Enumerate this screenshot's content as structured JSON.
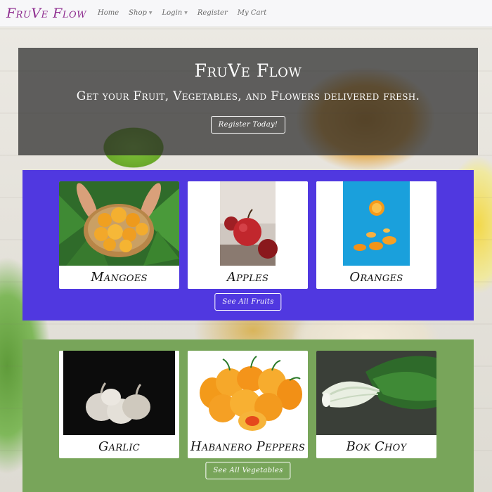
{
  "navbar": {
    "brand": "FruVe Flow",
    "items": [
      {
        "label": "Home"
      },
      {
        "label": "Shop"
      },
      {
        "label": "Login"
      },
      {
        "label": "Register"
      },
      {
        "label": "My Cart"
      }
    ]
  },
  "hero": {
    "title": "FruVe Flow",
    "subtitle": "Get your Fruit, Vegetables, and Flowers delivered fresh.",
    "cta": "Register Today!"
  },
  "fruits": {
    "items": [
      {
        "name": "Mangoes"
      },
      {
        "name": "Apples"
      },
      {
        "name": "Oranges"
      }
    ],
    "cta": "See All Fruits"
  },
  "vegetables": {
    "items": [
      {
        "name": "Garlic"
      },
      {
        "name": "Habanero Peppers"
      },
      {
        "name": "Bok Choy"
      }
    ],
    "cta": "See All Vegetables"
  },
  "colors": {
    "brand": "#8e2c8f",
    "fruits_bg": "#5038e0",
    "vegetables_bg": "#78a55a"
  }
}
